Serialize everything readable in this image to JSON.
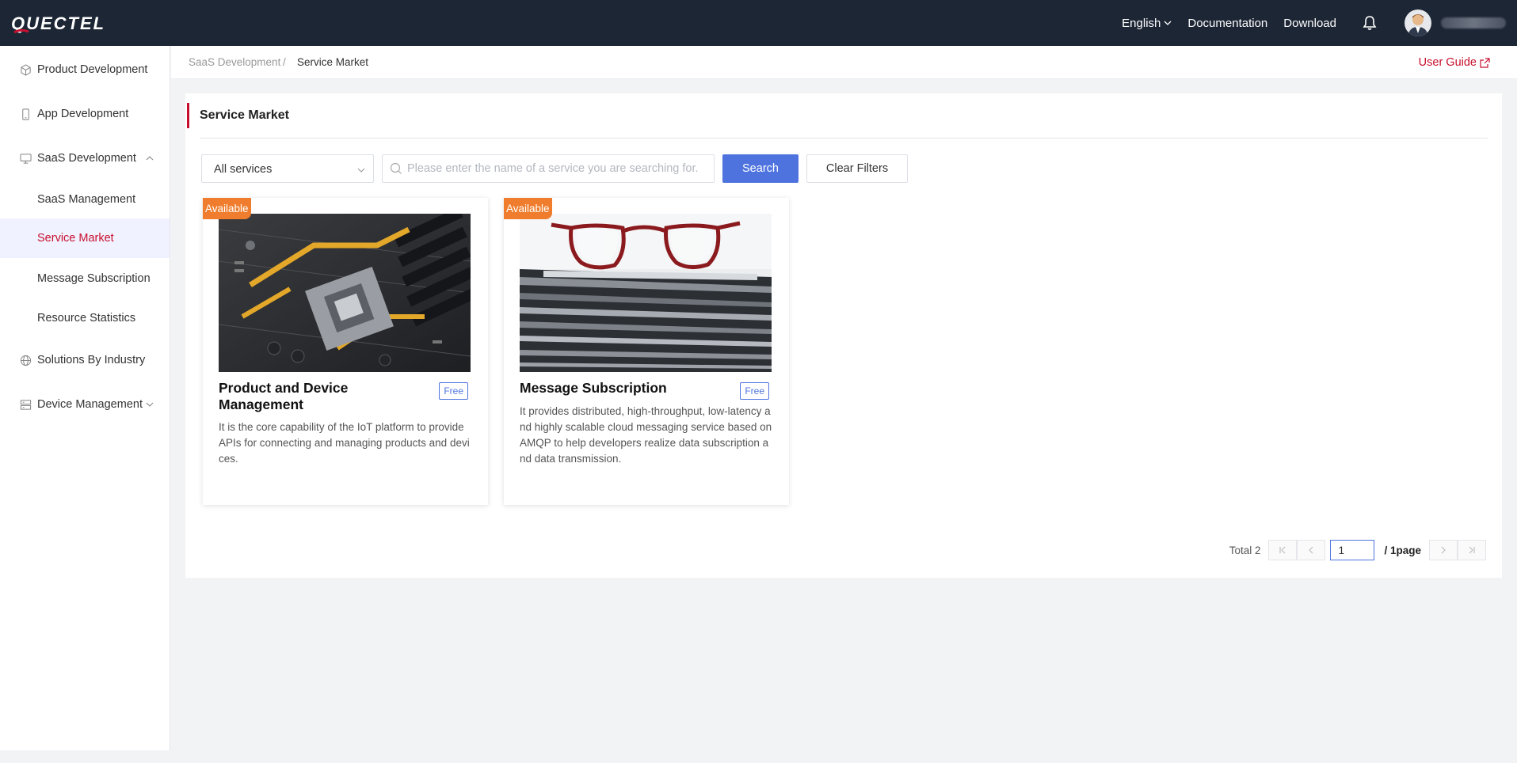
{
  "header": {
    "logo_text": "QUECTEL",
    "language": "English",
    "documentation": "Documentation",
    "download": "Download"
  },
  "sidebar": {
    "items": [
      {
        "label": "Product Development",
        "icon": "cube-icon"
      },
      {
        "label": "App Development",
        "icon": "phone-icon"
      },
      {
        "label": "SaaS Development",
        "icon": "monitor-icon",
        "expanded": true
      },
      {
        "label": "SaaS Management"
      },
      {
        "label": "Service Market",
        "active": true
      },
      {
        "label": "Message Subscription"
      },
      {
        "label": "Resource Statistics"
      },
      {
        "label": "Solutions By Industry",
        "icon": "globe-icon"
      },
      {
        "label": "Device Management",
        "icon": "server-icon"
      }
    ]
  },
  "breadcrumb": {
    "parent": "SaaS Development",
    "separator": "/",
    "current": "Service Market"
  },
  "user_guide": "User Guide",
  "page": {
    "title": "Service Market"
  },
  "filters": {
    "select_value": "All services",
    "search_placeholder": "Please enter the name of a service you are searching for.",
    "search_button": "Search",
    "clear_button": "Clear Filters"
  },
  "cards": [
    {
      "badge": "Available",
      "title": "Product and Device Management",
      "tag": "Free",
      "description": "It is the core capability of the IoT platform to provide APIs for connecting and managing products and devices."
    },
    {
      "badge": "Available",
      "title": "Message Subscription",
      "tag": "Free",
      "description": "It provides distributed, high-throughput, low-latency and highly scalable cloud messaging service based on AMQP to help developers realize data subscription and data transmission."
    }
  ],
  "pagination": {
    "total": "Total 2",
    "current_page": "1",
    "of_pages": "/ 1page"
  },
  "colors": {
    "header_bg": "#1d2635",
    "accent_red": "#c8102e",
    "primary_blue": "#4e73df",
    "badge_orange": "#ef7d2d"
  }
}
